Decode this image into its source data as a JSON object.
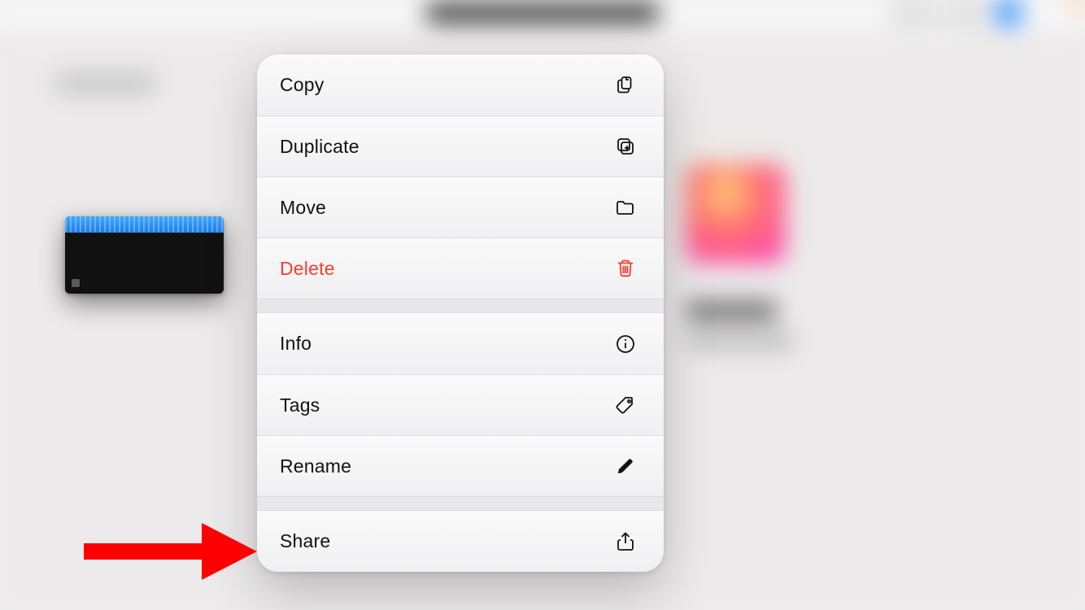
{
  "colors": {
    "destructive": "#ff3b30",
    "accent": "#2e8fff"
  },
  "preview": {
    "kind": "audio-project-thumbnail"
  },
  "menu": {
    "groups": [
      {
        "items": [
          {
            "key": "copy",
            "label": "Copy",
            "icon": "copy-icon",
            "destructive": false
          },
          {
            "key": "duplicate",
            "label": "Duplicate",
            "icon": "duplicate-icon",
            "destructive": false
          },
          {
            "key": "move",
            "label": "Move",
            "icon": "folder-icon",
            "destructive": false
          },
          {
            "key": "delete",
            "label": "Delete",
            "icon": "trash-icon",
            "destructive": true
          }
        ]
      },
      {
        "items": [
          {
            "key": "info",
            "label": "Info",
            "icon": "info-icon",
            "destructive": false
          },
          {
            "key": "tags",
            "label": "Tags",
            "icon": "tag-icon",
            "destructive": false
          },
          {
            "key": "rename",
            "label": "Rename",
            "icon": "pencil-icon",
            "destructive": false
          }
        ]
      },
      {
        "items": [
          {
            "key": "share",
            "label": "Share",
            "icon": "share-icon",
            "destructive": false
          }
        ]
      }
    ]
  },
  "annotation": {
    "points_to": "share",
    "color": "#ff0000"
  }
}
